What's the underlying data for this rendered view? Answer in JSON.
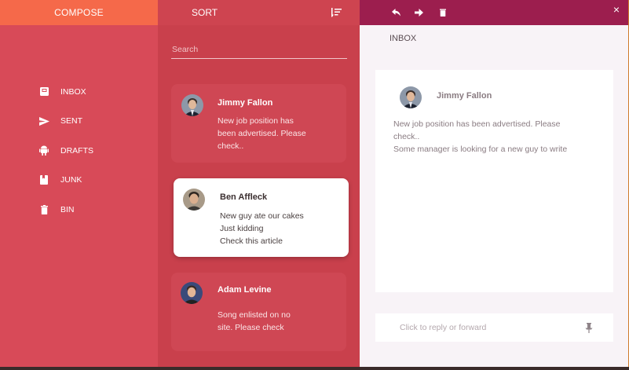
{
  "nav": {
    "compose_label": "COMPOSE",
    "items": [
      {
        "label": "INBOX",
        "icon": "inbox-icon"
      },
      {
        "label": "SENT",
        "icon": "send-icon"
      },
      {
        "label": "DRAFTS",
        "icon": "android-icon"
      },
      {
        "label": "JUNK",
        "icon": "bookmark-icon"
      },
      {
        "label": "BIN",
        "icon": "trash-icon"
      }
    ]
  },
  "list": {
    "sort_label": "SORT",
    "sort_icon": "sort-icon",
    "search_placeholder": "Search",
    "messages": [
      {
        "sender": "Jimmy Fallon",
        "lines": [
          "New job position has",
          "been advertised. Please",
          "check.."
        ],
        "selected": false
      },
      {
        "sender": "Ben Affleck",
        "lines": [
          "New guy ate our cakes",
          "Just kidding",
          "Check this article"
        ],
        "selected": true
      },
      {
        "sender": "Adam Levine",
        "lines": [
          "Song enlisted on no",
          "site. Please check"
        ],
        "selected": false
      }
    ]
  },
  "pane": {
    "toolbar": {
      "icons": [
        "reply-icon",
        "forward-icon",
        "delete-icon",
        "close-icon"
      ],
      "close_glyph": "×"
    },
    "title": "INBOX",
    "message": {
      "sender": "Jimmy Fallon",
      "body_lines": [
        "New job position has been advertised. Please",
        "check..",
        "Some manager is looking for a new guy to write"
      ]
    },
    "reply_placeholder": "Click to reply or forward",
    "pin_icon": "pin-icon"
  },
  "colors": {
    "nav_bg": "#d84a58",
    "compose_bg": "#f5694a",
    "list_bg": "#c9404c",
    "toolbar_bg": "#9c1e4e",
    "pane_bg": "#f8f3f7"
  }
}
